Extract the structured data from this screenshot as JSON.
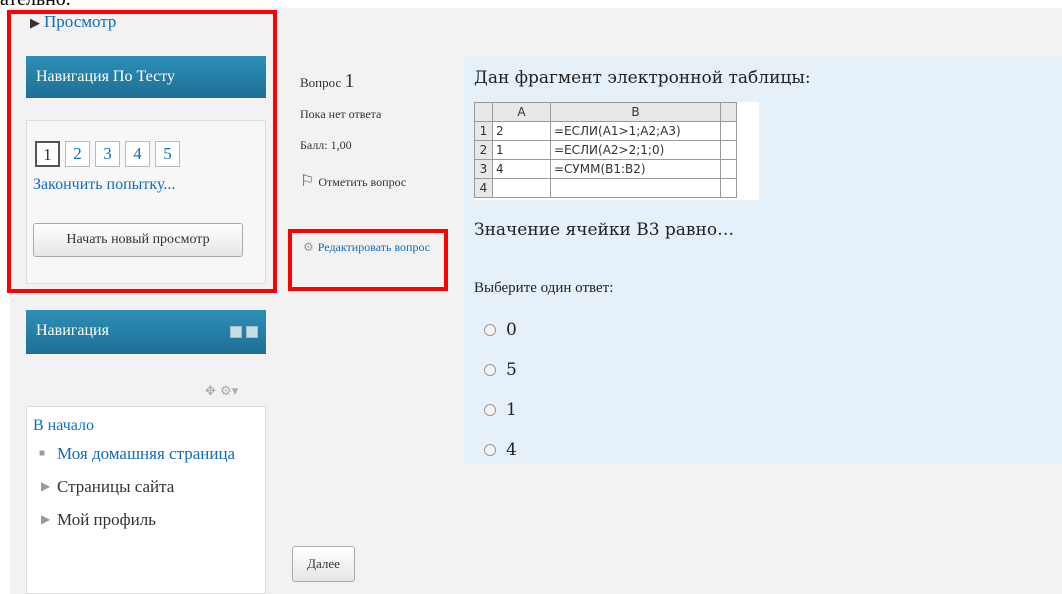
{
  "top_cut_text": "ательно.",
  "preview": {
    "label": "Просмотр"
  },
  "quiz_navigation": {
    "title": "Навигация По Тесту",
    "questions": [
      "1",
      "2",
      "3",
      "4",
      "5"
    ],
    "current": "1",
    "finish_label": "Закончить попытку...",
    "new_preview_label": "Начать новый просмотр"
  },
  "navigation": {
    "title": "Навигация",
    "home": "В начало",
    "items": [
      {
        "label": "Моя домашняя страница",
        "type": "bullet",
        "link": true
      },
      {
        "label": "Страницы сайта",
        "type": "collapsed",
        "link": false
      },
      {
        "label": "Мой профиль",
        "type": "collapsed",
        "link": false
      }
    ]
  },
  "question_info": {
    "prefix": "Вопрос",
    "number": "1",
    "status": "Пока нет ответа",
    "grade": "Балл: 1,00",
    "flag_label": "Отметить вопрос",
    "edit_label": "Редактировать вопрос"
  },
  "question": {
    "prompt": "Дан фрагмент электронной таблицы:",
    "sheet": {
      "headers": [
        "",
        "A",
        "B",
        ""
      ],
      "rows": [
        [
          "1",
          "2",
          "=ЕСЛИ(A1>1;A2;A3)",
          ""
        ],
        [
          "2",
          "1",
          "=ЕСЛИ(A2>2;1;0)",
          ""
        ],
        [
          "3",
          "4",
          "=СУММ(B1:B2)",
          ""
        ],
        [
          "4",
          "",
          "",
          ""
        ]
      ]
    },
    "text": "Значение ячейки B3 равно…",
    "choose_label": "Выберите один ответ:",
    "answers": [
      "0",
      "5",
      "1",
      "4"
    ]
  },
  "next_label": "Далее",
  "colors": {
    "link": "#0f6cbf",
    "block_header": "#2d8fb8",
    "highlight": "#ff0000",
    "question_bg": "#e6f0f9"
  }
}
